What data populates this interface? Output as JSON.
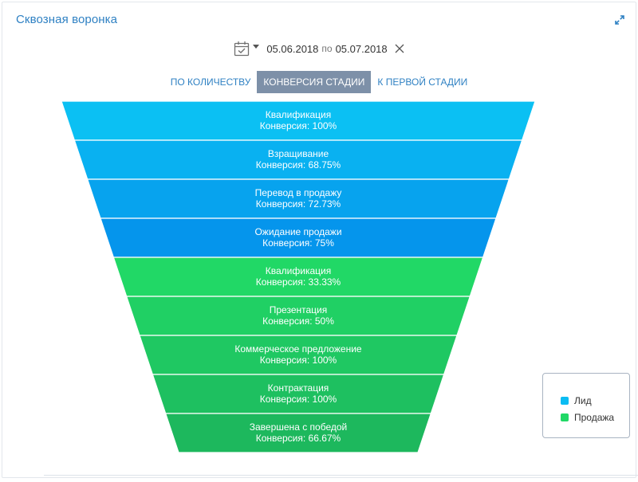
{
  "widget": {
    "title": "Сквозная воронка",
    "icons": {
      "expand": "expand-arrows-icon",
      "calendar": "calendar-check-icon",
      "caret": "caret-down-icon",
      "clear": "close-x-icon"
    }
  },
  "period": {
    "from": "05.06.2018",
    "separator": "по",
    "to": "05.07.2018"
  },
  "tabs": [
    {
      "label": "ПО КОЛИЧЕСТВУ",
      "active": false
    },
    {
      "label": "КОНВЕРСИЯ СТАДИИ",
      "active": true
    },
    {
      "label": "К ПЕРВОЙ СТАДИИ",
      "active": false
    }
  ],
  "colors": {
    "accent": "#2f81c3",
    "tab_active": "#7d90a8"
  },
  "chart_data": {
    "type": "funnel",
    "value_label": "Конверсия",
    "stages": [
      {
        "name": "Квалификация",
        "conversion": "100%",
        "series": "Лид",
        "color": "#0bc0f3"
      },
      {
        "name": "Взращивание",
        "conversion": "68.75%",
        "series": "Лид",
        "color": "#09b1f1"
      },
      {
        "name": "Перевод в продажу",
        "conversion": "72.73%",
        "series": "Лид",
        "color": "#07a3ee"
      },
      {
        "name": "Ожидание продажи",
        "conversion": "75%",
        "series": "Лид",
        "color": "#0595ec"
      },
      {
        "name": "Квалификация",
        "conversion": "33.33%",
        "series": "Продажа",
        "color": "#21d866"
      },
      {
        "name": "Презентация",
        "conversion": "50%",
        "series": "Продажа",
        "color": "#20d064"
      },
      {
        "name": "Коммерческое предложение",
        "conversion": "100%",
        "series": "Продажа",
        "color": "#1fc862"
      },
      {
        "name": "Контрактация",
        "conversion": "100%",
        "series": "Продажа",
        "color": "#1ec060"
      },
      {
        "name": "Завершена с победой",
        "conversion": "66.67%",
        "series": "Продажа",
        "color": "#1db85d"
      }
    ],
    "legend": [
      {
        "name": "Лид",
        "color": "#0bbcf3"
      },
      {
        "name": "Продажа",
        "color": "#21d866"
      }
    ]
  }
}
